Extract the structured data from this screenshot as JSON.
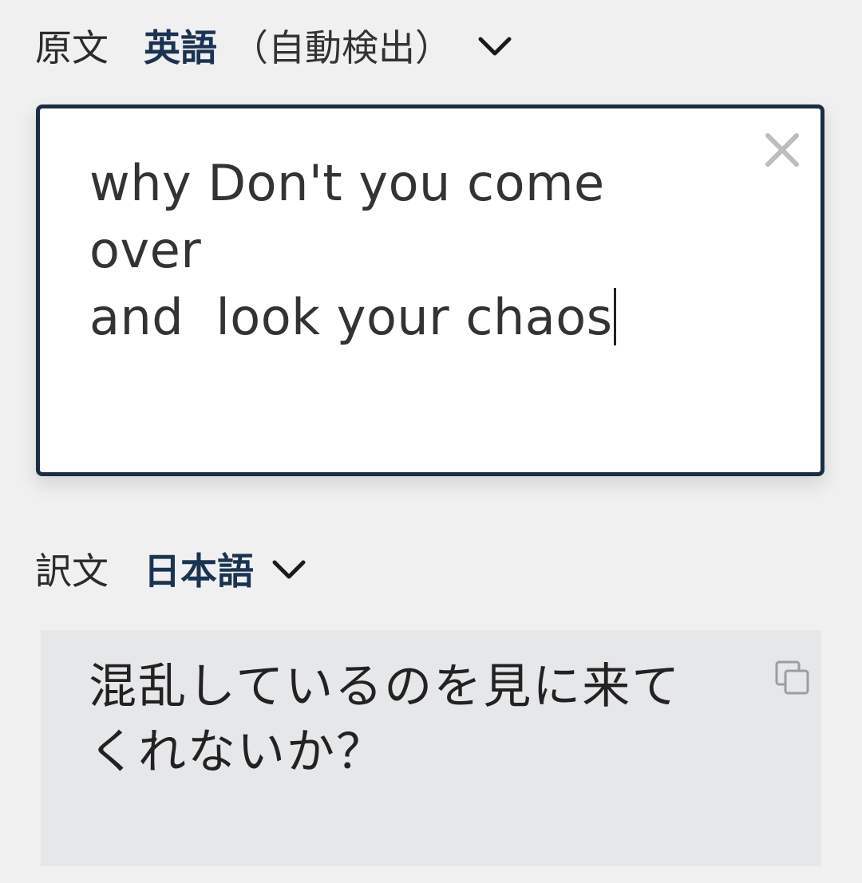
{
  "source": {
    "label": "原文",
    "language": "英語",
    "language_note": "（自動検出）",
    "dropdown_icon": "chevron-down-icon",
    "text": "why Don't you come over\nand  look your chaos",
    "clear_icon": "close-icon"
  },
  "target": {
    "label": "訳文",
    "language": "日本語",
    "dropdown_icon": "chevron-down-icon",
    "text": "混乱しているのを見に来てくれないか？",
    "copy_icon": "copy-icon"
  },
  "colors": {
    "accent": "#1b3352",
    "box_border": "#1b2d44",
    "background": "#f0f0f0",
    "result_background": "#e6e7e9"
  }
}
